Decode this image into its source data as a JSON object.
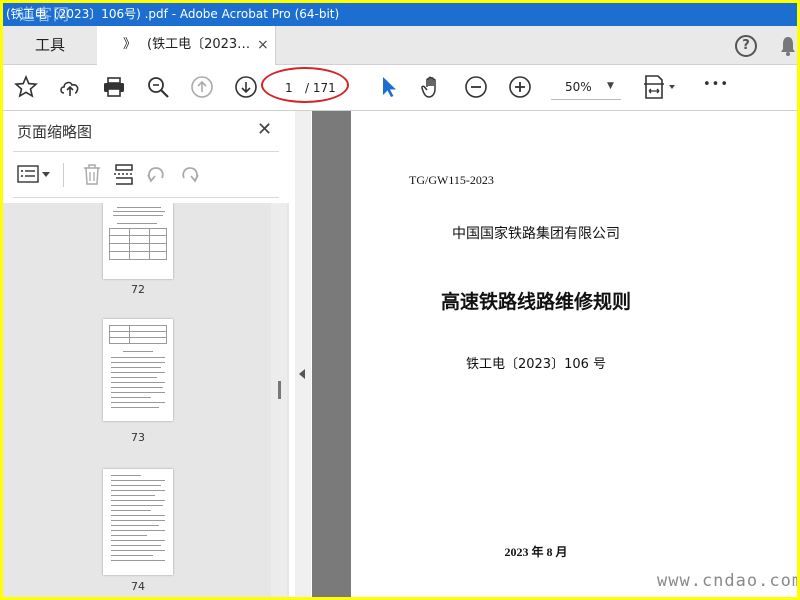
{
  "window": {
    "title": "(铁工电〔2023〕106号) .pdf - Adobe Acrobat Pro (64-bit)",
    "watermark_top": "道客网"
  },
  "tabs": {
    "tools_label": "工具",
    "doc_chevron": "》",
    "doc_label": "(铁工电〔2023…",
    "close_glyph": "×",
    "help_glyph": "?"
  },
  "toolbar": {
    "current_page": "1",
    "total_pages": "/ 171",
    "zoom": "50%",
    "zoom_dropdown": "▼",
    "more_glyph": "•••"
  },
  "panel": {
    "title": "页面缩略图",
    "close_glyph": "✕",
    "thumbnails": [
      {
        "page": "72"
      },
      {
        "page": "73"
      },
      {
        "page": "74"
      }
    ]
  },
  "document": {
    "code": "TG/GW115-2023",
    "organization": "中国国家铁路集团有限公司",
    "title": "高速铁路线路维修规则",
    "doc_number": "铁工电〔2023〕106 号",
    "date": "2023 年  8 月"
  },
  "colors": {
    "titlebar": "#1c6fd0",
    "frame": "#ffff00",
    "annotation_oval": "#d42424",
    "select_tool": "#1c6fd0"
  },
  "watermark_bottom": "www.cndao.com"
}
